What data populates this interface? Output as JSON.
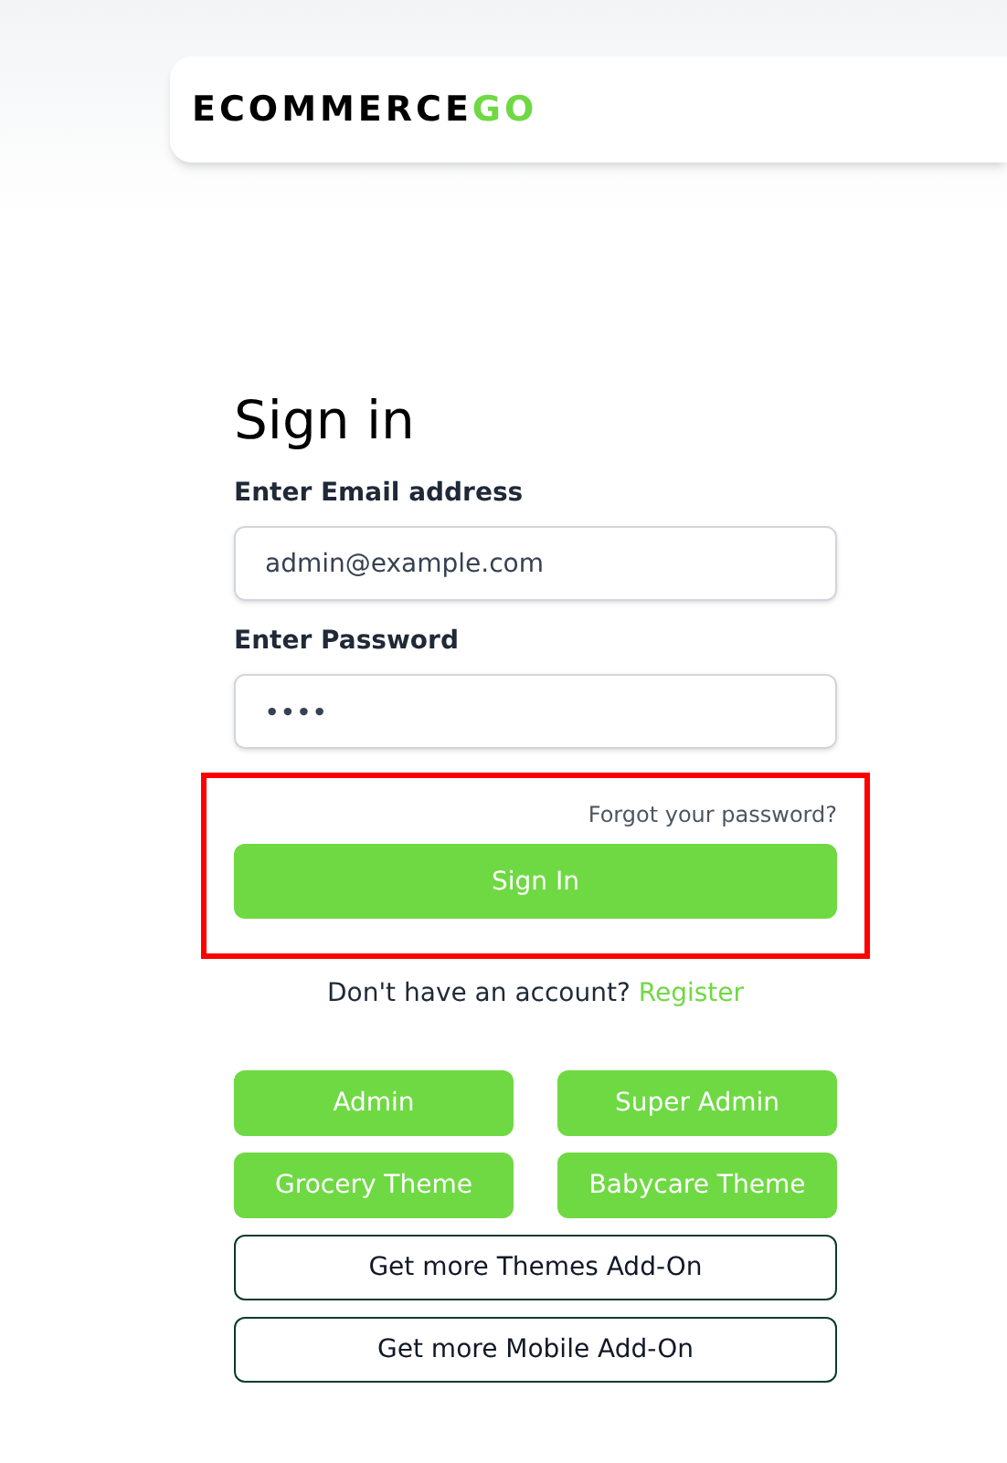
{
  "logo": {
    "text": "ECOMMERCE",
    "accent": "GO"
  },
  "form": {
    "title": "Sign in",
    "fields": [
      {
        "label": "Enter Email address",
        "value": "admin@example.com",
        "kind": "text"
      },
      {
        "label": "Enter Password",
        "value": "••••",
        "kind": "password"
      }
    ],
    "forgot_link": "Forgot your password?",
    "submit": "Sign In",
    "highlighted": true,
    "register_prompt": "Don't have an account?",
    "register_link": "Register"
  },
  "quick_buttons": [
    {
      "label": "Admin",
      "kind": "filled"
    },
    {
      "label": "Super Admin",
      "kind": "filled"
    },
    {
      "label": "Grocery Theme",
      "kind": "filled"
    },
    {
      "label": "Babycare Theme",
      "kind": "filled"
    },
    {
      "label": "Get more Themes Add-On",
      "kind": "outline"
    },
    {
      "label": "Get more Mobile Add-On",
      "kind": "outline"
    }
  ]
}
